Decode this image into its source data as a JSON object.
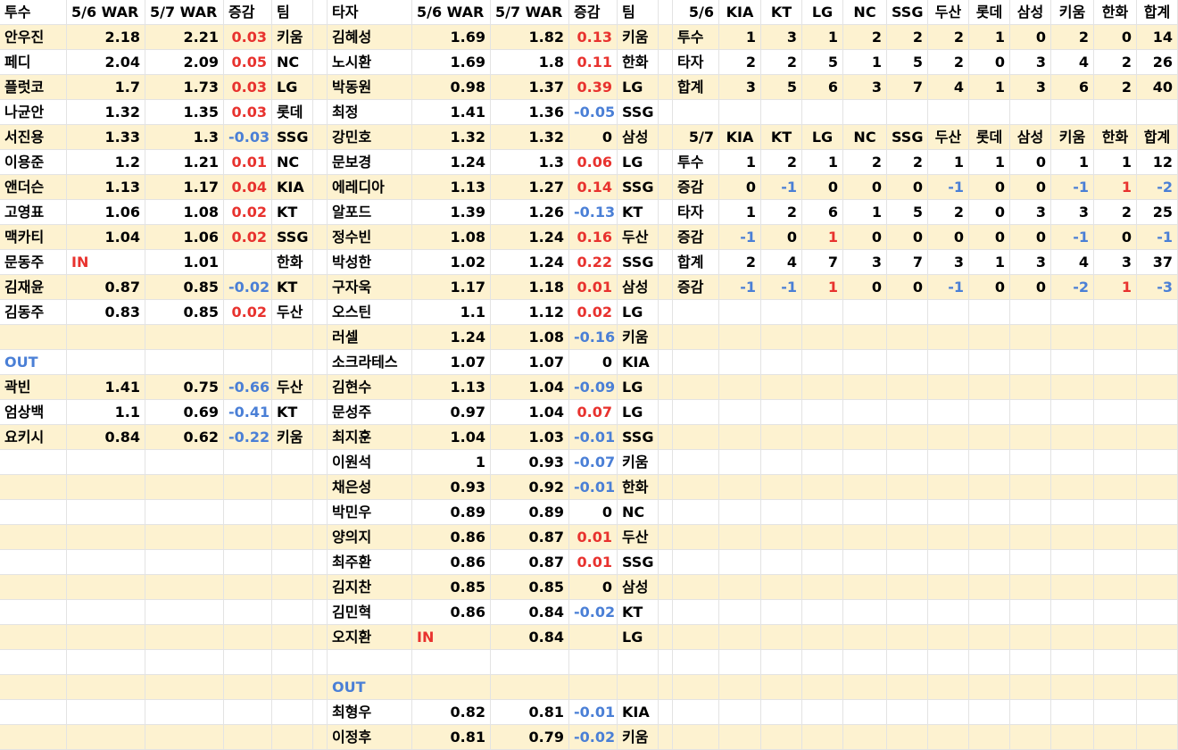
{
  "grid": {
    "rows": [
      [
        "투수",
        "5/6 WAR",
        "5/7 WAR",
        "증감",
        "팀",
        "",
        "타자",
        "5/6 WAR",
        "5/7 WAR",
        "증감",
        "팀",
        "",
        "5/6",
        "KIA",
        "KT",
        "LG",
        "NC",
        "SSG",
        "두산",
        "롯데",
        "삼성",
        "키움",
        "한화",
        "합계"
      ],
      [
        "안우진",
        "2.18",
        "2.21",
        "0.03",
        "키움",
        "",
        "김혜성",
        "1.69",
        "1.82",
        "0.13",
        "키움",
        "",
        "투수",
        "1",
        "3",
        "1",
        "2",
        "2",
        "2",
        "1",
        "0",
        "2",
        "0",
        "14"
      ],
      [
        "페디",
        "2.04",
        "2.09",
        "0.05",
        "NC",
        "",
        "노시환",
        "1.69",
        "1.8",
        "0.11",
        "한화",
        "",
        "타자",
        "2",
        "2",
        "5",
        "1",
        "5",
        "2",
        "0",
        "3",
        "4",
        "2",
        "26"
      ],
      [
        "플럿코",
        "1.7",
        "1.73",
        "0.03",
        "LG",
        "",
        "박동원",
        "0.98",
        "1.37",
        "0.39",
        "LG",
        "",
        "합계",
        "3",
        "5",
        "6",
        "3",
        "7",
        "4",
        "1",
        "3",
        "6",
        "2",
        "40"
      ],
      [
        "나균안",
        "1.32",
        "1.35",
        "0.03",
        "롯데",
        "",
        "최정",
        "1.41",
        "1.36",
        "-0.05",
        "SSG",
        "",
        "",
        "",
        "",
        "",
        "",
        "",
        "",
        "",
        "",
        "",
        "",
        ""
      ],
      [
        "서진용",
        "1.33",
        "1.3",
        "-0.03",
        "SSG",
        "",
        "강민호",
        "1.32",
        "1.32",
        "0",
        "삼성",
        "",
        "5/7",
        "KIA",
        "KT",
        "LG",
        "NC",
        "SSG",
        "두산",
        "롯데",
        "삼성",
        "키움",
        "한화",
        "합계"
      ],
      [
        "이용준",
        "1.2",
        "1.21",
        "0.01",
        "NC",
        "",
        "문보경",
        "1.24",
        "1.3",
        "0.06",
        "LG",
        "",
        "투수",
        "1",
        "2",
        "1",
        "2",
        "2",
        "1",
        "1",
        "0",
        "1",
        "1",
        "12"
      ],
      [
        "앤더슨",
        "1.13",
        "1.17",
        "0.04",
        "KIA",
        "",
        "에레디아",
        "1.13",
        "1.27",
        "0.14",
        "SSG",
        "",
        "증감",
        "0",
        "-1",
        "0",
        "0",
        "0",
        "-1",
        "0",
        "0",
        "-1",
        "1",
        "-2"
      ],
      [
        "고영표",
        "1.06",
        "1.08",
        "0.02",
        "KT",
        "",
        "알포드",
        "1.39",
        "1.26",
        "-0.13",
        "KT",
        "",
        "타자",
        "1",
        "2",
        "6",
        "1",
        "5",
        "2",
        "0",
        "3",
        "3",
        "2",
        "25"
      ],
      [
        "맥카티",
        "1.04",
        "1.06",
        "0.02",
        "SSG",
        "",
        "정수빈",
        "1.08",
        "1.24",
        "0.16",
        "두산",
        "",
        "증감",
        "-1",
        "0",
        "1",
        "0",
        "0",
        "0",
        "0",
        "0",
        "-1",
        "0",
        "-1"
      ],
      [
        "문동주",
        "IN",
        "1.01",
        "",
        "한화",
        "",
        "박성한",
        "1.02",
        "1.24",
        "0.22",
        "SSG",
        "",
        "합계",
        "2",
        "4",
        "7",
        "3",
        "7",
        "3",
        "1",
        "3",
        "4",
        "3",
        "37"
      ],
      [
        "김재윤",
        "0.87",
        "0.85",
        "-0.02",
        "KT",
        "",
        "구자욱",
        "1.17",
        "1.18",
        "0.01",
        "삼성",
        "",
        "증감",
        "-1",
        "-1",
        "1",
        "0",
        "0",
        "-1",
        "0",
        "0",
        "-2",
        "1",
        "-3"
      ],
      [
        "김동주",
        "0.83",
        "0.85",
        "0.02",
        "두산",
        "",
        "오스틴",
        "1.1",
        "1.12",
        "0.02",
        "LG",
        "",
        "",
        "",
        "",
        "",
        "",
        "",
        "",
        "",
        "",
        "",
        "",
        ""
      ],
      [
        "",
        "",
        "",
        "",
        "",
        "",
        "러셀",
        "1.24",
        "1.08",
        "-0.16",
        "키움",
        "",
        "",
        "",
        "",
        "",
        "",
        "",
        "",
        "",
        "",
        "",
        "",
        ""
      ],
      [
        "OUT",
        "",
        "",
        "",
        "",
        "",
        "소크라테스",
        "1.07",
        "1.07",
        "0",
        "KIA",
        "",
        "",
        "",
        "",
        "",
        "",
        "",
        "",
        "",
        "",
        "",
        "",
        ""
      ],
      [
        "곽빈",
        "1.41",
        "0.75",
        "-0.66",
        "두산",
        "",
        "김현수",
        "1.13",
        "1.04",
        "-0.09",
        "LG",
        "",
        "",
        "",
        "",
        "",
        "",
        "",
        "",
        "",
        "",
        "",
        "",
        ""
      ],
      [
        "엄상백",
        "1.1",
        "0.69",
        "-0.41",
        "KT",
        "",
        "문성주",
        "0.97",
        "1.04",
        "0.07",
        "LG",
        "",
        "",
        "",
        "",
        "",
        "",
        "",
        "",
        "",
        "",
        "",
        "",
        ""
      ],
      [
        "요키시",
        "0.84",
        "0.62",
        "-0.22",
        "키움",
        "",
        "최지훈",
        "1.04",
        "1.03",
        "-0.01",
        "SSG",
        "",
        "",
        "",
        "",
        "",
        "",
        "",
        "",
        "",
        "",
        "",
        "",
        ""
      ],
      [
        "",
        "",
        "",
        "",
        "",
        "",
        "이원석",
        "1",
        "0.93",
        "-0.07",
        "키움",
        "",
        "",
        "",
        "",
        "",
        "",
        "",
        "",
        "",
        "",
        "",
        "",
        ""
      ],
      [
        "",
        "",
        "",
        "",
        "",
        "",
        "채은성",
        "0.93",
        "0.92",
        "-0.01",
        "한화",
        "",
        "",
        "",
        "",
        "",
        "",
        "",
        "",
        "",
        "",
        "",
        "",
        ""
      ],
      [
        "",
        "",
        "",
        "",
        "",
        "",
        "박민우",
        "0.89",
        "0.89",
        "0",
        "NC",
        "",
        "",
        "",
        "",
        "",
        "",
        "",
        "",
        "",
        "",
        "",
        "",
        ""
      ],
      [
        "",
        "",
        "",
        "",
        "",
        "",
        "양의지",
        "0.86",
        "0.87",
        "0.01",
        "두산",
        "",
        "",
        "",
        "",
        "",
        "",
        "",
        "",
        "",
        "",
        "",
        "",
        ""
      ],
      [
        "",
        "",
        "",
        "",
        "",
        "",
        "최주환",
        "0.86",
        "0.87",
        "0.01",
        "SSG",
        "",
        "",
        "",
        "",
        "",
        "",
        "",
        "",
        "",
        "",
        "",
        "",
        ""
      ],
      [
        "",
        "",
        "",
        "",
        "",
        "",
        "김지찬",
        "0.85",
        "0.85",
        "0",
        "삼성",
        "",
        "",
        "",
        "",
        "",
        "",
        "",
        "",
        "",
        "",
        "",
        "",
        ""
      ],
      [
        "",
        "",
        "",
        "",
        "",
        "",
        "김민혁",
        "0.86",
        "0.84",
        "-0.02",
        "KT",
        "",
        "",
        "",
        "",
        "",
        "",
        "",
        "",
        "",
        "",
        "",
        "",
        ""
      ],
      [
        "",
        "",
        "",
        "",
        "",
        "",
        "오지환",
        "IN",
        "0.84",
        "",
        "LG",
        "",
        "",
        "",
        "",
        "",
        "",
        "",
        "",
        "",
        "",
        "",
        "",
        ""
      ],
      [
        "",
        "",
        "",
        "",
        "",
        "",
        "",
        "",
        "",
        "",
        "",
        "",
        "",
        "",
        "",
        "",
        "",
        "",
        "",
        "",
        "",
        "",
        "",
        ""
      ],
      [
        "",
        "",
        "",
        "",
        "",
        "",
        "OUT",
        "",
        "",
        "",
        "",
        "",
        "",
        "",
        "",
        "",
        "",
        "",
        "",
        "",
        "",
        "",
        "",
        ""
      ],
      [
        "",
        "",
        "",
        "",
        "",
        "",
        "최형우",
        "0.82",
        "0.81",
        "-0.01",
        "KIA",
        "",
        "",
        "",
        "",
        "",
        "",
        "",
        "",
        "",
        "",
        "",
        "",
        ""
      ],
      [
        "",
        "",
        "",
        "",
        "",
        "",
        "이정후",
        "0.81",
        "0.79",
        "-0.02",
        "키움",
        "",
        "",
        "",
        "",
        "",
        "",
        "",
        "",
        "",
        "",
        "",
        "",
        ""
      ]
    ],
    "banded_rows": [
      1,
      3,
      5,
      7,
      9,
      11,
      13,
      15,
      17,
      19,
      21,
      23,
      25,
      27,
      29
    ],
    "colors": {
      "band": "#fdf2d0",
      "positive": "#e8322e",
      "negative": "#4a7fd6",
      "out_label": "#4a7fd6",
      "in_label": "#e8322e",
      "gridline": "#e3e3e3"
    }
  }
}
